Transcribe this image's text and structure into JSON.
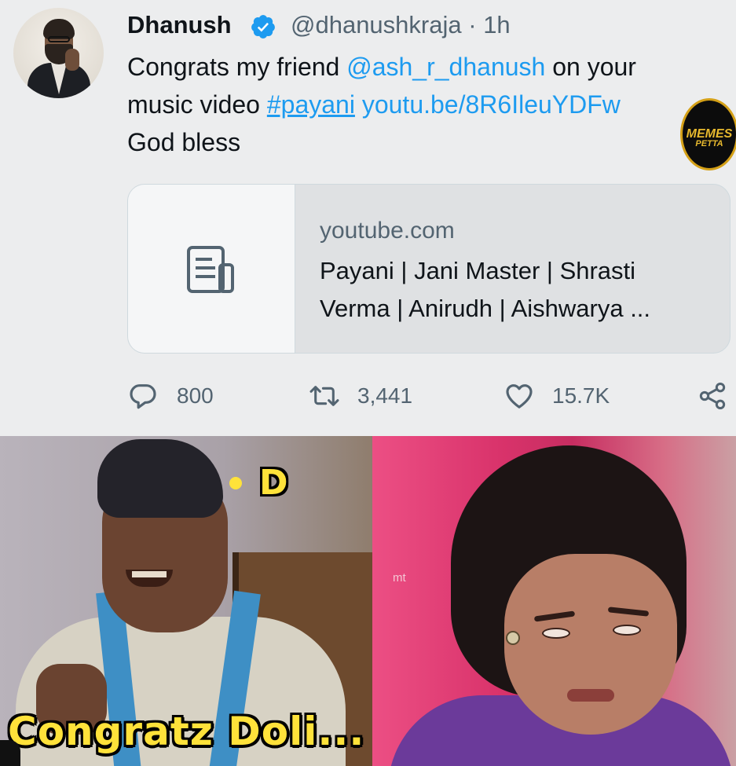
{
  "tweet": {
    "author": {
      "name": "Dhanush",
      "verified": true,
      "handle": "@dhanushkraja",
      "separator": "·",
      "time": "1h"
    },
    "more_label": "•••",
    "text": {
      "line1_prefix": "Congrats my friend ",
      "mention": "@ash_r_dhanush",
      "line1_suffix": " on your",
      "line2_prefix": "music video ",
      "hashtag": "#payani",
      "url": "youtu.be/8R6IleuYDFw",
      "line3": "God bless"
    },
    "card": {
      "domain": "youtube.com",
      "title_line1": "Payani | Jani Master | Shrasti",
      "title_line2": "Verma | Anirudh | Aishwarya ..."
    },
    "actions": {
      "replies": "800",
      "retweets": "3,441",
      "likes": "15.7K"
    }
  },
  "watermark_logo": {
    "line1": "MEMES",
    "line2": "PETTA"
  },
  "meme": {
    "tag_letter": "D",
    "caption": "Congratz Doli...",
    "watermark": "mt"
  },
  "colors": {
    "accent": "#1d9bf0",
    "caption": "#ffe23a",
    "background": "#ecedee",
    "secondary_text": "#536471"
  },
  "icons": {
    "verified": "verified-badge-icon",
    "more": "more-horizontal-icon",
    "card": "document-icon",
    "reply": "reply-icon",
    "retweet": "retweet-icon",
    "like": "heart-icon",
    "share": "share-icon"
  }
}
